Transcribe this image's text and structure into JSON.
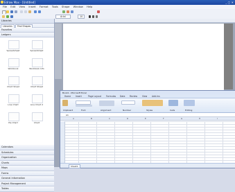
{
  "window": {
    "title": "Edraw Max - [Untitled]",
    "controls": "_ ▢ ✕"
  },
  "menu": [
    "File",
    "Edit",
    "View",
    "Insert",
    "Format",
    "Tools",
    "Shape",
    "Window",
    "Help"
  ],
  "toolbar2": {
    "font_value": "Arial",
    "size_value": "10"
  },
  "library": {
    "header": "Libraries",
    "tabs": [
      "Libraries",
      "Find Shapes"
    ],
    "top_categories": [
      "Favorites",
      "Ledgers"
    ],
    "shapes": [
      "Spreadsheet",
      "Spreadsheet",
      "Workbook",
      "Workbook Info",
      "Chart Sheet",
      "Chart Sheet",
      "Line Chart",
      "Line Chart 2",
      "Pie Chart",
      "Chart"
    ],
    "bottom_categories": [
      "Calendars",
      "Schedules",
      "Organization",
      "Charts",
      "Maps",
      "Forms",
      "General Information",
      "Project Management",
      "Tables"
    ]
  },
  "excel": {
    "title": "Book1 - Microsoft Excel",
    "tabs": [
      "Home",
      "Insert",
      "Page Layout",
      "Formulas",
      "Data",
      "Review",
      "View",
      "Add-Ins"
    ],
    "ribbon_groups": [
      "Clipboard",
      "Font",
      "Alignment",
      "Number",
      "Styles",
      "Cells",
      "Editing"
    ],
    "name_box": "A1",
    "columns": [
      "A",
      "B",
      "C",
      "D",
      "E",
      "F",
      "G",
      "H",
      "I"
    ],
    "sheet_tab": "Sheet1"
  }
}
